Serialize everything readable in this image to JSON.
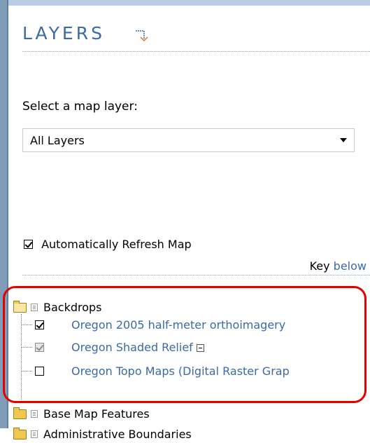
{
  "panel": {
    "title": "LAYERS"
  },
  "select_layer": {
    "label": "Select a map layer:",
    "value": "All Layers"
  },
  "refresh": {
    "label": "Automatically Refresh Map",
    "checked": true
  },
  "key": {
    "prefix": "Key",
    "link": "below"
  },
  "tree": {
    "groups": [
      {
        "label": "Backdrops",
        "expanded": true,
        "layers": [
          {
            "label": "Oregon 2005 half-meter orthoimagery",
            "checked": true
          },
          {
            "label": "Oregon Shaded Relief",
            "checked": true,
            "disabled": true
          },
          {
            "label": "Oregon Topo Maps (Digital Raster Grap",
            "checked": false
          }
        ]
      },
      {
        "label": "Base Map Features",
        "expanded": false
      },
      {
        "label": "Administrative Boundaries",
        "expanded": false
      }
    ]
  },
  "colors": {
    "title": "#3a6aa8",
    "link": "#3a6aa8",
    "highlight": "#e50000",
    "folder": "#f0c850"
  }
}
